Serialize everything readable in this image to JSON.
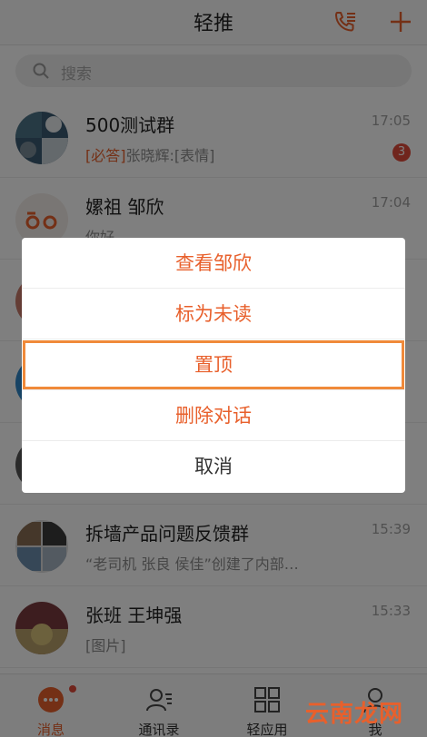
{
  "header": {
    "title": "轻推",
    "call_icon": "phone-list-icon",
    "add_icon": "plus-icon",
    "accent": "#e8602c"
  },
  "search": {
    "placeholder": "搜索"
  },
  "chats": [
    {
      "name": "500测试群",
      "time": "17:05",
      "preview_tag": "[必答]",
      "preview": "张晓辉:[表情]",
      "badge": "3"
    },
    {
      "name": "嫘祖 邹欣",
      "time": "17:04",
      "preview_tag": "",
      "preview": "你好",
      "badge": ""
    },
    {
      "name": "",
      "time": "",
      "preview_tag": "",
      "preview": "",
      "badge": ""
    },
    {
      "name": "",
      "time": "",
      "preview_tag": "",
      "preview": "",
      "badge": ""
    },
    {
      "name": "",
      "time": "",
      "preview_tag": "",
      "preview": "",
      "badge": ""
    },
    {
      "name": "拆墙产品问题反馈群",
      "time": "15:39",
      "preview_tag": "",
      "preview": "“老司机 张良 侯佳”创建了内部…",
      "badge": ""
    },
    {
      "name": "张班  王坤强",
      "time": "15:33",
      "preview_tag": "",
      "preview": "[图片]",
      "badge": ""
    }
  ],
  "dialog": {
    "options": [
      "查看邹欣",
      "标为未读",
      "置顶",
      "删除对话",
      "取消"
    ]
  },
  "nav": {
    "items": [
      {
        "label": "消息",
        "icon": "chat-bubble-icon"
      },
      {
        "label": "通讯录",
        "icon": "contacts-icon"
      },
      {
        "label": "轻应用",
        "icon": "apps-grid-icon"
      },
      {
        "label": "我",
        "icon": "person-icon"
      }
    ]
  },
  "watermark": "云南龙网"
}
